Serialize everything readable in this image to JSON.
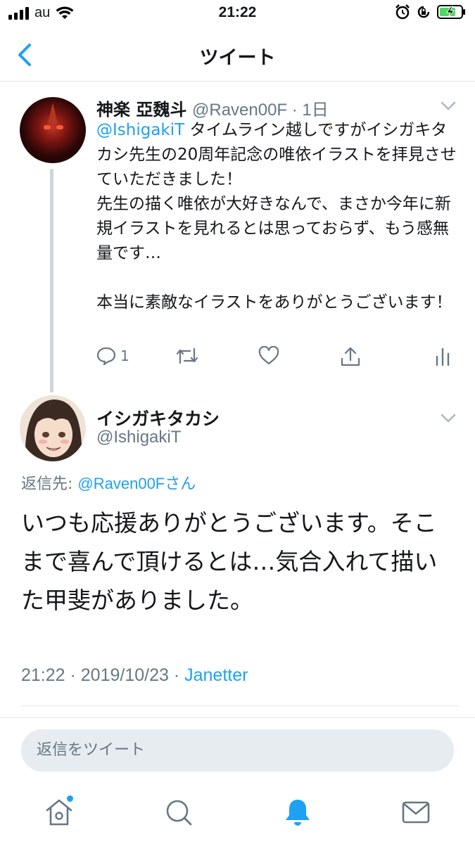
{
  "status_bar": {
    "carrier": "au",
    "time": "21:22",
    "icons": [
      "signal-icon",
      "wifi-icon",
      "alarm-icon",
      "rotation-lock-icon",
      "battery-charging-icon"
    ]
  },
  "nav": {
    "title": "ツイート",
    "back_icon": "chevron-left-icon"
  },
  "tweet1": {
    "display_name": "神楽 亞魏斗",
    "meta": "@Raven00F · 1日",
    "mention": "@IshigakiT",
    "body_after_mention": " タイムライン越しですがイシガキタカシ先生の20周年記念の唯依イラストを拝見させていただきました！\n先生の描く唯依が大好きなんで、まさか今年に新規イラストを見れるとは思っておらず、もう感無量です…\n\n本当に素敵なイラストをありがとうございます！",
    "reply_count": "1",
    "actions": [
      "reply-icon",
      "retweet-icon",
      "like-icon",
      "share-icon",
      "analytics-icon"
    ]
  },
  "tweet2": {
    "display_name": "イシガキタカシ",
    "handle": "@IshigakiT",
    "reply_prefix": "返信先: ",
    "reply_mention": "@Raven00Fさん",
    "body": "いつも応援ありがとうございます。そこまで喜んで頂けるとは…気合入れて描いた甲斐がありました。",
    "timestamp": "21:22 · 2019/10/23 · ",
    "source_app": "Janetter"
  },
  "reply_box": {
    "placeholder": "返信をツイート"
  },
  "tab_bar": {
    "items": [
      "home-icon",
      "search-icon",
      "notifications-icon",
      "messages-icon"
    ]
  },
  "colors": {
    "accent": "#1da1f2",
    "secondary_text": "#657786",
    "primary_text": "#14171a",
    "divider": "#e1e8ed"
  }
}
